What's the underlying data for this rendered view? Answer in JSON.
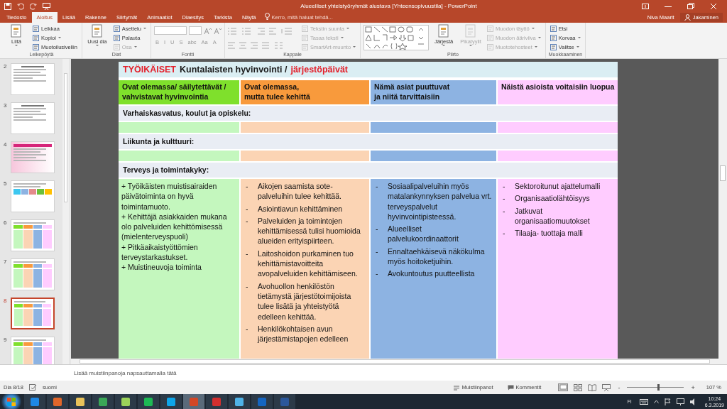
{
  "window": {
    "title": "Alueelliset yhteistyöryhmät alustava [Yhteensopivuustila] - PowerPoint"
  },
  "tabs": [
    {
      "label": "Tiedosto",
      "selected": false
    },
    {
      "label": "Aloitus",
      "selected": true
    },
    {
      "label": "Lisää",
      "selected": false
    },
    {
      "label": "Rakenne",
      "selected": false
    },
    {
      "label": "Siirtymät",
      "selected": false
    },
    {
      "label": "Animaatiot",
      "selected": false
    },
    {
      "label": "Diaesitys",
      "selected": false
    },
    {
      "label": "Tarkista",
      "selected": false
    },
    {
      "label": "Näytä",
      "selected": false
    }
  ],
  "tell_me": {
    "placeholder": "Kerro, mitä haluat tehdä..."
  },
  "user": "Niva Maarit",
  "share_button": "Jakaminen",
  "ribbon": [
    {
      "label": "Leikepöytä",
      "columns": [
        [
          {
            "kind": "large",
            "label": "Liitä",
            "dropdown": true,
            "disabled": false
          }
        ],
        [
          {
            "kind": "small",
            "label": "Leikkaa",
            "dropdown": false,
            "disabled": false
          },
          {
            "kind": "small",
            "label": "Kopioi",
            "dropdown": true,
            "disabled": false
          },
          {
            "kind": "small",
            "label": "Muotoilusivellin",
            "dropdown": false,
            "disabled": false
          }
        ]
      ]
    },
    {
      "label": "Diat",
      "columns": [
        [
          {
            "kind": "large",
            "label": "Uusi dia",
            "dropdown": true,
            "disabled": false
          }
        ],
        [
          {
            "kind": "small",
            "label": "Asettelu",
            "dropdown": true,
            "disabled": false
          },
          {
            "kind": "small",
            "label": "Palauta",
            "dropdown": false,
            "disabled": false
          },
          {
            "kind": "small",
            "label": "Osa",
            "dropdown": true,
            "disabled": true
          }
        ]
      ]
    },
    {
      "label": "Fontti",
      "columns": [
        [
          {
            "kind": "font",
            "buttons": [
              "B",
              "I",
              "U",
              "S",
              "abc",
              "Aa",
              "A"
            ]
          }
        ]
      ]
    },
    {
      "label": "Kappale",
      "columns": [
        [
          {
            "kind": "paragraph"
          }
        ],
        [
          {
            "kind": "small",
            "label": "Tekstin suunta",
            "dropdown": true,
            "disabled": true
          },
          {
            "kind": "small",
            "label": "Tasaa teksti",
            "dropdown": true,
            "disabled": true
          },
          {
            "kind": "small",
            "label": "SmartArt-muunto",
            "dropdown": true,
            "disabled": true
          }
        ]
      ]
    },
    {
      "label": "Piirto",
      "columns": [
        [
          {
            "kind": "shapes"
          }
        ],
        [
          {
            "kind": "large",
            "label": "Järjestä",
            "dropdown": true,
            "disabled": false
          }
        ],
        [
          {
            "kind": "large",
            "label": "Pikatyylit",
            "dropdown": true,
            "disabled": true
          }
        ],
        [
          {
            "kind": "small",
            "label": "Muodon täyttö",
            "dropdown": true,
            "disabled": true
          },
          {
            "kind": "small",
            "label": "Muodon ääriviiva",
            "dropdown": true,
            "disabled": true
          },
          {
            "kind": "small",
            "label": "Muototehosteet",
            "dropdown": true,
            "disabled": true
          }
        ]
      ]
    },
    {
      "label": "Muokkaaminen",
      "columns": [
        [
          {
            "kind": "small",
            "label": "Etsi",
            "dropdown": false,
            "disabled": false
          },
          {
            "kind": "small",
            "label": "Korvaa",
            "dropdown": true,
            "disabled": false
          },
          {
            "kind": "small",
            "label": "Valitse",
            "dropdown": true,
            "disabled": false
          }
        ]
      ]
    }
  ],
  "thumbnails": [
    {
      "number": "2",
      "kind": "text",
      "selected": false
    },
    {
      "number": "3",
      "kind": "text",
      "selected": false
    },
    {
      "number": "4",
      "kind": "pink",
      "selected": false
    },
    {
      "number": "5",
      "kind": "colorful",
      "selected": false
    },
    {
      "number": "6",
      "kind": "table",
      "selected": false
    },
    {
      "number": "7",
      "kind": "table",
      "selected": false
    },
    {
      "number": "8",
      "kind": "table",
      "selected": true
    },
    {
      "number": "9",
      "kind": "table",
      "selected": false
    }
  ],
  "slide": {
    "title": [
      {
        "text": "TYÖIKÄISET",
        "color": "#e3202b"
      },
      {
        "text": "Kuntalaisten hyvinvointi /",
        "color": "#1a1a1a"
      },
      {
        "text": "järjestöpäivät",
        "color": "#e3202b"
      }
    ],
    "columns": [
      {
        "lines": [
          "Ovat olemassa/ säilytettävät /",
          "vahvistavat hyvinvointia"
        ],
        "color": "#7fe02c"
      },
      {
        "lines": [
          "Ovat olemassa,",
          "mutta tulee kehittä"
        ],
        "color": "#f89a3c"
      },
      {
        "lines": [
          "Nämä asiat puuttuvat",
          "ja niitä tarvittaisiin"
        ],
        "color": "#8db3e2"
      },
      {
        "lines": [
          "Näistä asioista voitaisiin luopua"
        ],
        "color": "#ffccff"
      }
    ],
    "sections": [
      {
        "heading": "Varhaiskasvatus, koulut ja opiskelu:",
        "cells": [
          {
            "color": "#c4f7be"
          },
          {
            "color": "#fbd4b4"
          },
          {
            "color": "#8db3e2"
          },
          {
            "color": "#ffccff"
          }
        ]
      },
      {
        "heading": "Liikunta ja kulttuuri:",
        "cells": [
          {
            "color": "#c4f7be"
          },
          {
            "color": "#fbd4b4"
          },
          {
            "color": "#8db3e2"
          },
          {
            "color": "#ffccff"
          }
        ]
      },
      {
        "heading": "Terveys ja toimintakyky:",
        "cells": [
          {
            "color": "#c4f7be",
            "items": [
              {
                "text": "+ Työikäisten muistisairaiden päivätoiminta on hyvä toimintamuoto."
              },
              {
                "text": "+ Kehittäjä asiakkaiden mukana olo palveluiden kehittömisessä (mielenterveyspuoli)"
              },
              {
                "text": "+ Pitkäaikaistyöttömien terveystarkastukset."
              },
              {
                "text": "+ Muistineuvoja toiminta"
              }
            ]
          },
          {
            "color": "#fbd4b4",
            "items": [
              {
                "bullet": "-",
                "text": "Aikojen saamista sote-palveluihin tulee kehittää."
              },
              {
                "bullet": "-",
                "text": "Asiointiavun  kehittäminen"
              },
              {
                "bullet": "-",
                "text": "Palveluiden ja toimintojen kehittämisessä tulisi huomioida alueiden erityispiirteen."
              },
              {
                "bullet": "-",
                "text": "Laitoshoidon purkaminen tuo kehittämistavoitteita avopalveluiden kehittämiseen."
              },
              {
                "bullet": "-",
                "text": "Avohuollon henkilöstön tietämystä järjestötoimijoista tulee lisätä ja yhteistyötä edelleen kehittää."
              },
              {
                "bullet": "-",
                "text": "Henkilökohtaisen avun järjestämistapojen edelleen"
              }
            ]
          },
          {
            "color": "#8db3e2",
            "items": [
              {
                "bullet": "-",
                "text": "Sosiaalipalveluihin myös matalankynnyksen palvelua vrt. terveyspalvelut hyvinvointipisteessä."
              },
              {
                "bullet": "-",
                "text": "Alueelliset palvelukoordinaattorit"
              },
              {
                "bullet": "-",
                "text": "Ennaltaehkäisevä näkökulma myös hoitoketjuihin."
              },
              {
                "bullet": "-",
                "text": "Avokuntoutus puutteellista"
              }
            ]
          },
          {
            "color": "#ffccff",
            "items": [
              {
                "bullet": "-",
                "text": "Sektoroitunut ajattelumalli"
              },
              {
                "bullet": "-",
                "text": "Organisaatiolähtöisyys"
              },
              {
                "bullet": "-",
                "text": "Jatkuvat organisaatiomuutokset"
              },
              {
                "bullet": "-",
                "text": "Tilaaja- tuottaja  malli"
              }
            ]
          }
        ]
      }
    ]
  },
  "notes": {
    "placeholder": "Lisää muistiinpanoja napsauttamalla tätä"
  },
  "status_bar": {
    "slide_counter": "Dia 8/18",
    "language": "suomi",
    "notes_button": "Muistiinpanot",
    "comments_button": "Kommentit",
    "zoom": {
      "minus": "-",
      "plus": "+",
      "level": 0.55,
      "reading": "107 %"
    }
  },
  "taskbar": {
    "apps": [
      {
        "color": "#1e88e5",
        "selected": false
      },
      {
        "color": "#e0662a",
        "selected": false
      },
      {
        "color": "#e8c25a",
        "selected": false
      },
      {
        "color": "#3aa757",
        "selected": false
      },
      {
        "color": "#9bd35a",
        "selected": false
      },
      {
        "color": "#1db954",
        "selected": false
      },
      {
        "color": "#0ea5e9",
        "selected": false
      },
      {
        "color": "#d24726",
        "selected": true
      },
      {
        "color": "#d32f2f",
        "selected": false
      },
      {
        "color": "#4fb3e8",
        "selected": false
      },
      {
        "color": "#1565c0",
        "selected": false
      },
      {
        "color": "#2b579a",
        "selected": false
      }
    ],
    "language": "FI",
    "time": "10:24",
    "date": "6.3.2019"
  }
}
